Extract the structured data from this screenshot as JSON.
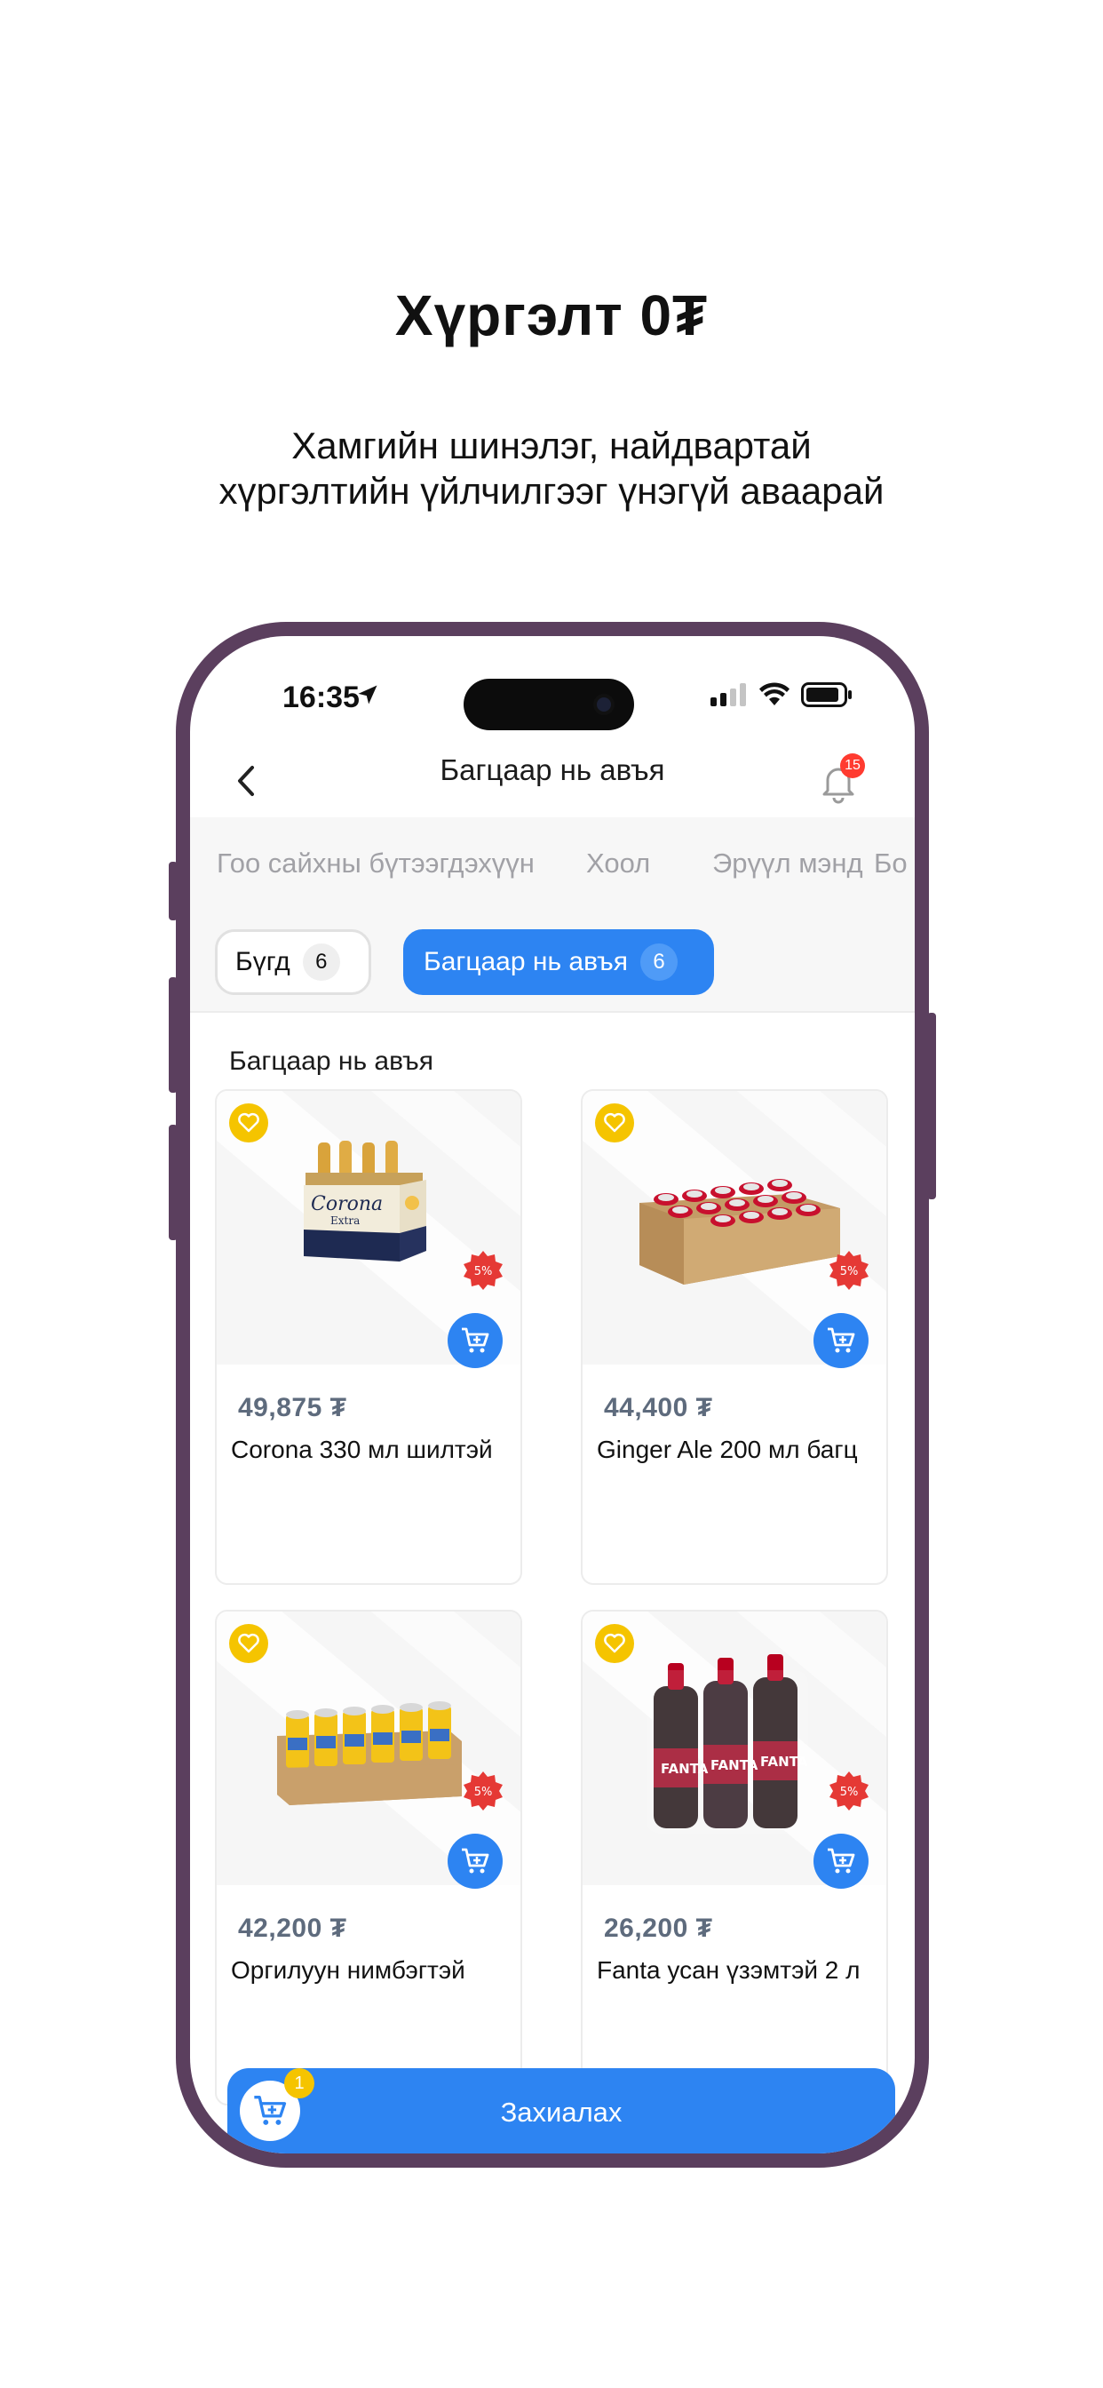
{
  "promo": {
    "headline": "Хүргэлт 0₮",
    "subline": "Хамгийн шинэлэг, найдвартай хүргэлтийн үйлчилгээг үнэгүй аваарай"
  },
  "status_bar": {
    "time": "16:35"
  },
  "nav": {
    "title": "Багцаар нь авъя",
    "notification_count": "15"
  },
  "categories": [
    "Гоо сайхны бүтээгдэхүүн",
    "Хоол",
    "Эрүүл мэнд",
    "Бо"
  ],
  "filters": [
    {
      "label": "Бүгд",
      "count": "6",
      "active": false
    },
    {
      "label": "Багцаар нь авъя",
      "count": "6",
      "active": true
    }
  ],
  "section_title": "Багцаар нь авъя",
  "products": [
    {
      "price": "49,875 ₮",
      "name": "Corona 330 мл шилтэй",
      "discount": "5%",
      "image": "corona-six-pack"
    },
    {
      "price": "44,400 ₮",
      "name": "Ginger Ale 200 мл багц",
      "discount": "5%",
      "image": "red-cans-tray"
    },
    {
      "price": "42,200 ₮",
      "name": "Оргилуун нимбэгтэй",
      "discount": "5%",
      "image": "yellow-cans-tray"
    },
    {
      "price": "26,200 ₮",
      "name": "Fanta усан үзэмтэй 2 л",
      "discount": "5%",
      "image": "fanta-bottles-pack"
    }
  ],
  "order": {
    "label": "Захиалах",
    "cart_count": "1"
  },
  "colors": {
    "accent": "#2d84f2",
    "favorite": "#f5c400",
    "discount": "#e53935",
    "frame": "#5b3f5e"
  }
}
